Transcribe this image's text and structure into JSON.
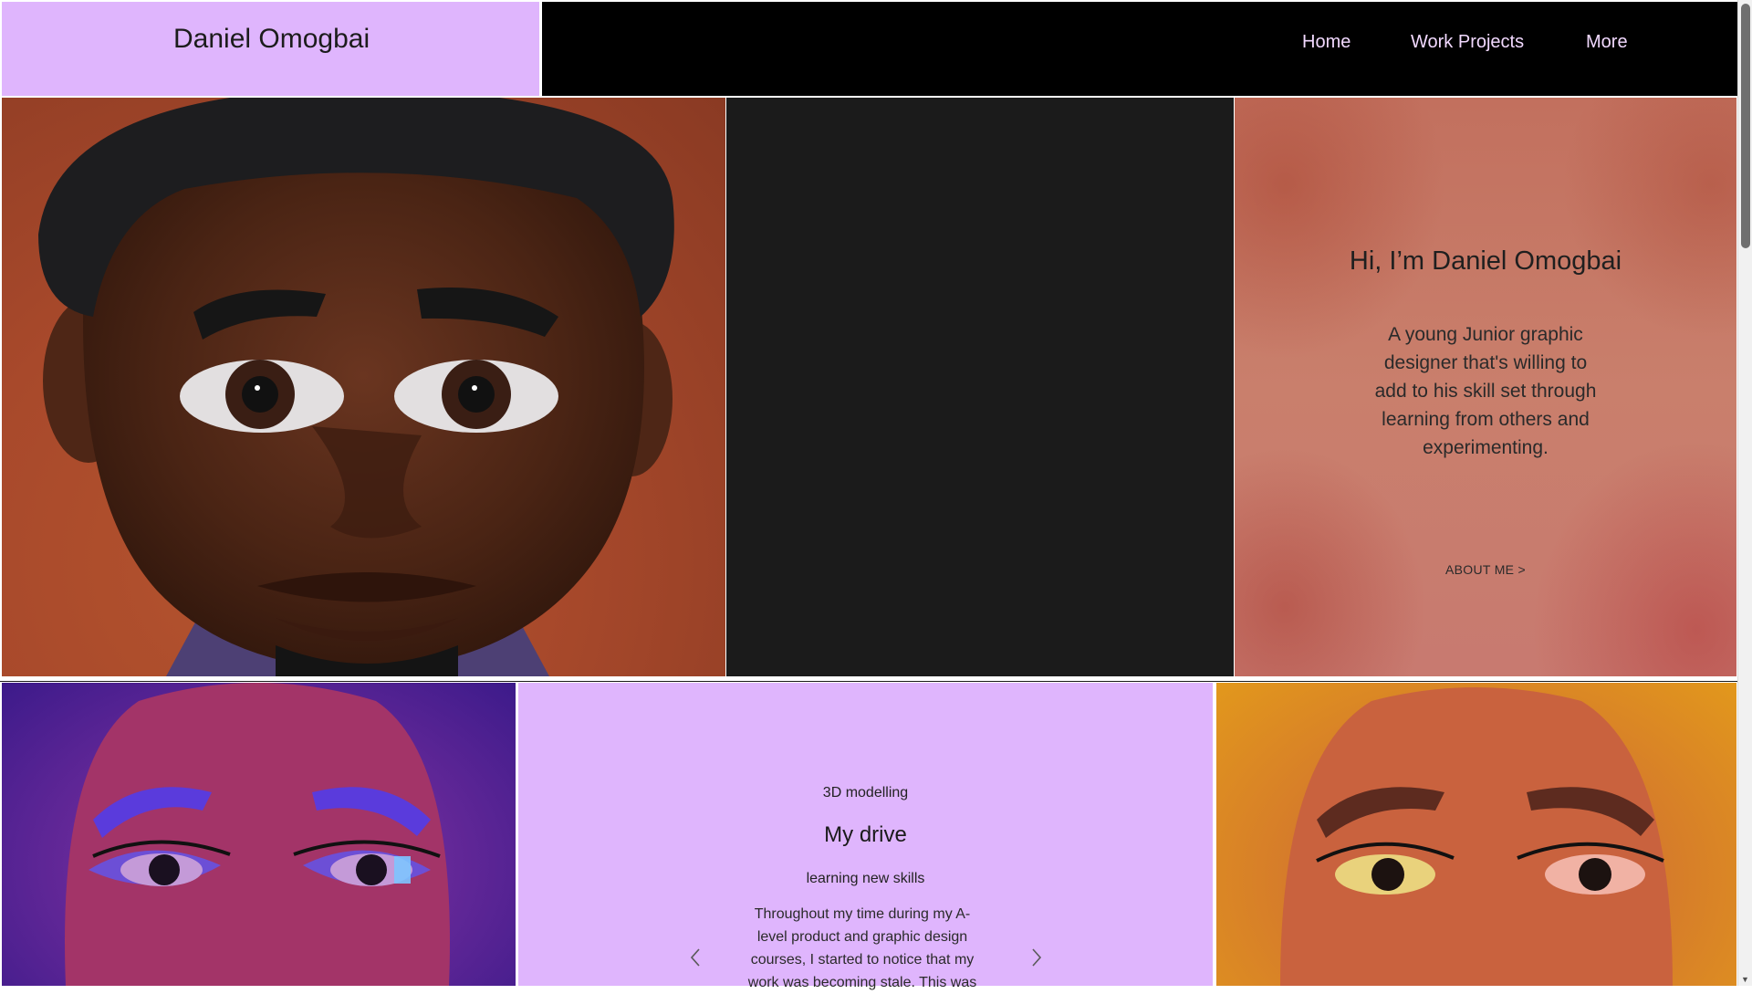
{
  "header": {
    "logo": "Daniel Omogbai",
    "nav": [
      {
        "label": "Home"
      },
      {
        "label": "Work Projects"
      },
      {
        "label": "More"
      }
    ]
  },
  "intro": {
    "title": "Hi, I’m Daniel Omogbai",
    "body": "A young Junior graphic designer that's willing to add to his skill set through learning from others and experimenting.",
    "link": "ABOUT ME  >"
  },
  "slide": {
    "kicker": "3D modelling",
    "title": "My drive",
    "subtitle": "learning new skills",
    "body": "Throughout my time during my A-level product and graphic design courses, I started to notice that my work was becoming stale. This was"
  },
  "colors": {
    "lilac": "#dfb5fd",
    "nav_text": "#f2d9ff",
    "dark_panel": "#1b1b1b"
  },
  "icons": {
    "prev": "chevron-left-icon",
    "next": "chevron-right-icon"
  }
}
